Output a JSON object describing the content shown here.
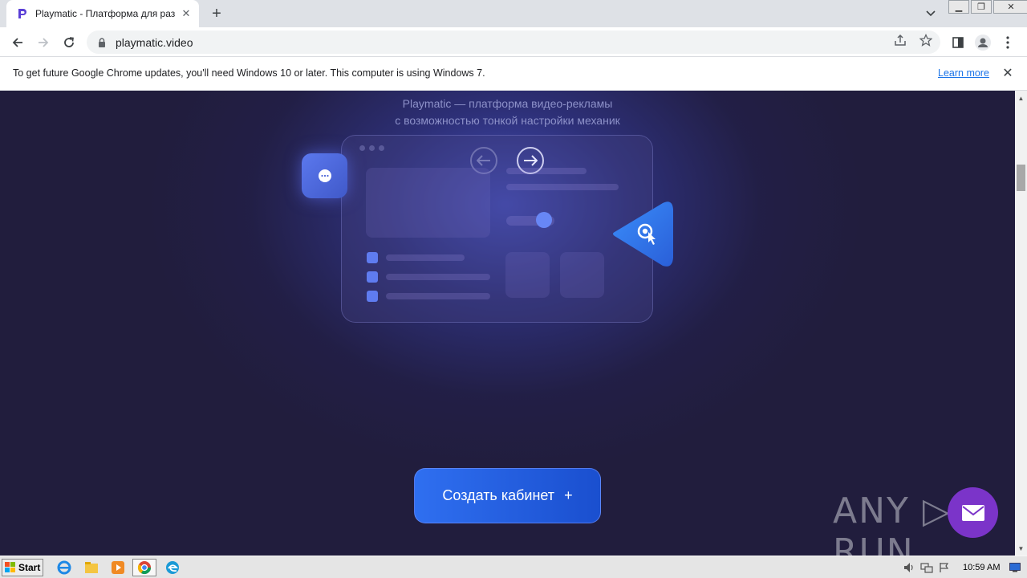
{
  "browser": {
    "tab": {
      "title": "Playmatic - Платформа для размещ",
      "favicon": "playmatic-p-icon"
    },
    "new_tab_label": "+",
    "url": "playmatic.video",
    "infobar": {
      "message": "To get future Google Chrome updates, you'll need Windows 10 or later. This computer is using Windows 7.",
      "link": "Learn more"
    }
  },
  "page": {
    "subtitle_line1": "Playmatic — платформа видео-рекламы",
    "subtitle_line2": "с возможностью тонкой настройки механик",
    "cta_label": "Создать кабинет",
    "cta_plus": "+",
    "accent": "#5f7cf0"
  },
  "watermark": {
    "text": "ANY ▷ RUN"
  },
  "taskbar": {
    "start_label": "Start",
    "clock": "10:59 AM"
  }
}
